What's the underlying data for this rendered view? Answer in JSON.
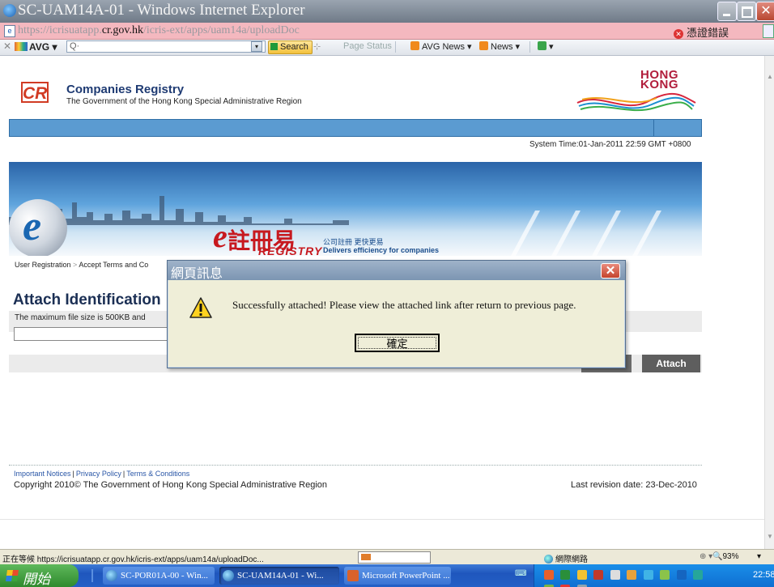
{
  "window": {
    "title": "SC-UAM14A-01 - Windows Internet Explorer"
  },
  "address": {
    "url_prefix": "https://icrisuatapp.",
    "url_domain": "cr.gov.hk",
    "url_path": "/icris-ext/apps/uam14a/uploadDoc",
    "cert_error": "憑證錯誤"
  },
  "toolbar": {
    "brand": "AVG",
    "search_placeholder": "Q·",
    "search_label": "Search",
    "page_status": "Page Status",
    "avg_news": "AVG News ▾",
    "news": "News ▾",
    "tools": "▾"
  },
  "site": {
    "logo_text": "CR",
    "name": "Companies Registry",
    "subtitle": "The Government of the Hong Kong Special Administrative Region",
    "hk_logo_line1": "HONG",
    "hk_logo_line2": "KONG",
    "system_time": "System Time:01-Jan-2011 22:59 GMT +0800"
  },
  "banner": {
    "brand_cn": "註冊易",
    "brand_en": "REGISTRY",
    "slogan_cn": "公司註冊 更快更易",
    "slogan_en": "Delivers efficiency for companies"
  },
  "page": {
    "breadcrumb_1": "User Registration",
    "breadcrumb_sep": ">",
    "breadcrumb_2": "Accept Terms and Co",
    "title": "Attach Identification",
    "hint": "The maximum file size is 500KB and",
    "attach_button": "Attach"
  },
  "footer": {
    "links": [
      "Important Notices",
      "Privacy Policy",
      "Terms & Conditions"
    ],
    "separator": "|",
    "copyright": "Copyright 2010© The Government of Hong Kong Special Administrative Region",
    "revision": "Last revision date: 23-Dec-2010"
  },
  "dialog": {
    "title": "網頁訊息",
    "message": "Successfully attached! Please view the attached link after return to previous page.",
    "ok_label": "確定"
  },
  "statusbar": {
    "text": "正在等候 https://icrisuatapp.cr.gov.hk/icris-ext/apps/uam14a/uploadDoc...",
    "zone": "網際網路",
    "protected": "⊕ ▾",
    "zoom": "🔍93%",
    "zoom_dropdown": "▾"
  },
  "taskbar": {
    "start_label": "開始",
    "tasks": [
      {
        "label": "SC-POR01A-00 - Win..."
      },
      {
        "label": "SC-UAM14A-01 - Wi..."
      },
      {
        "label": "Microsoft PowerPoint ..."
      }
    ],
    "clock": "22:58"
  },
  "colors": {
    "accent_blue": "#5b9bd1",
    "cr_red": "#d13b24",
    "button_gray": "#5e5e5e",
    "address_error": "#f4b8bf"
  }
}
